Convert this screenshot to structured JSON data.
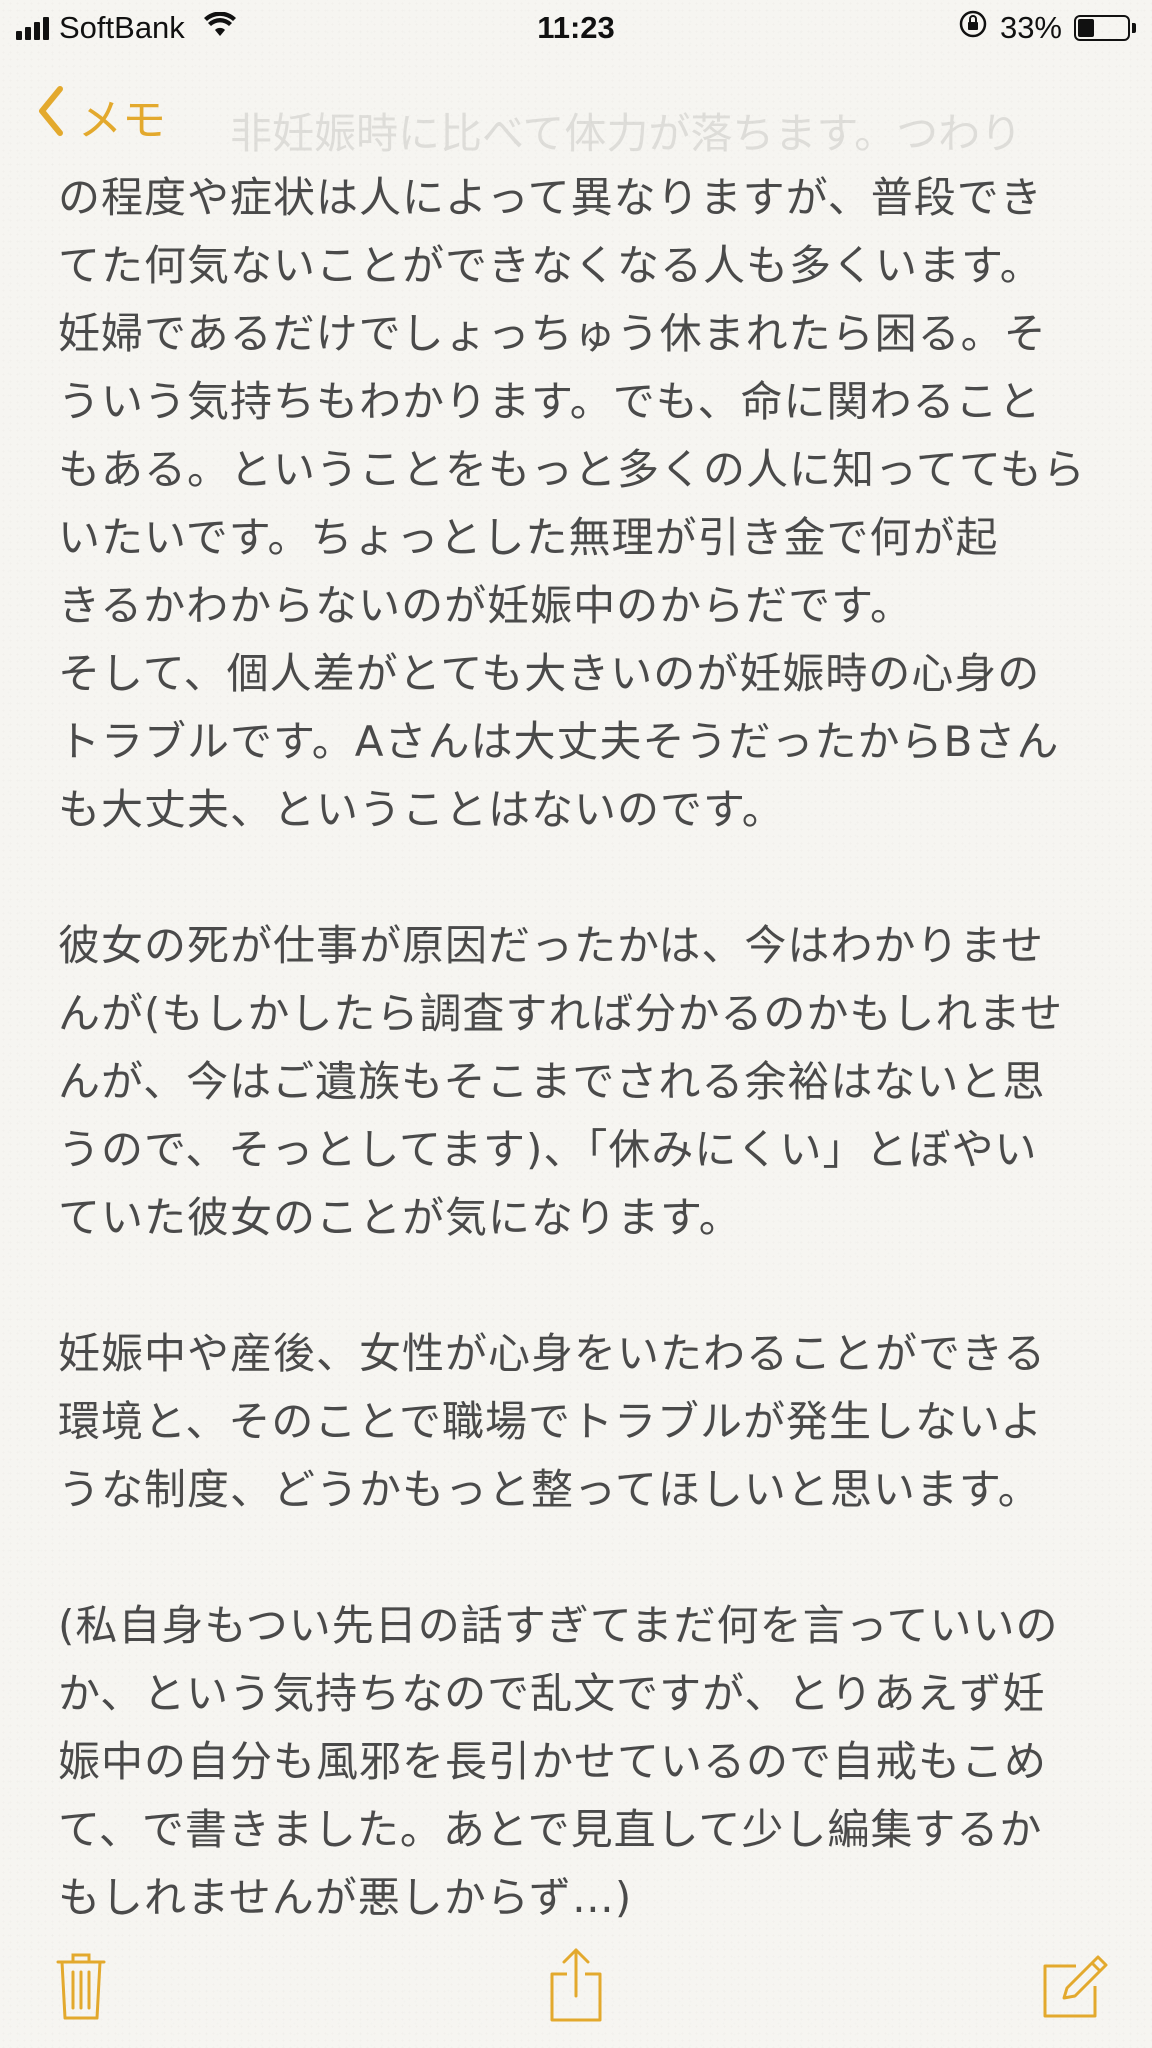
{
  "status_bar": {
    "carrier": "SoftBank",
    "time": "11:23",
    "battery_percent_label": "33%",
    "battery_level": 0.33,
    "icons": [
      "signal-icon",
      "wifi-icon",
      "orientation-lock-icon",
      "battery-icon"
    ]
  },
  "nav": {
    "back_label": "メモ",
    "faded_previous_line": "非妊娠時に比べて体力が落ちます。つわり"
  },
  "note": {
    "body": "の程度や症状は人によって異なりますが、普段でき\nてた何気ないことができなくなる人も多くいます。\n妊婦であるだけでしょっちゅう休まれたら困る。そ\nういう気持ちもわかります。でも、命に関わること\nもある。ということをもっと多くの人に知っててもら\nいたいです。ちょっとした無理が引き金で何が起\nきるかわからないのが妊娠中のからだです。\nそして、個人差がとても大きいのが妊娠時の心身の\nトラブルです。Aさんは大丈夫そうだったからBさん\nも大丈夫、ということはないのです。\n\n彼女の死が仕事が原因だったかは、今はわかりませ\nんが(もしかしたら調査すれば分かるのかもしれませ\nんが、今はご遺族もそこまでされる余裕はないと思\nうので、そっとしてます)、「休みにくい」とぼやい\nていた彼女のことが気になります。\n\n妊娠中や産後、女性が心身をいたわることができる\n環境と、そのことで職場でトラブルが発生しないよ\nうな制度、どうかもっと整ってほしいと思います。\n\n(私自身もつい先日の話すぎてまだ何を言っていいの\nか、という気持ちなので乱文ですが、とりあえず妊\n娠中の自分も風邪を長引かせているので自戒もこめ\nて、で書きました。あとで見直して少し編集するか\nもしれませんが悪しからず…)"
  },
  "toolbar": {
    "icons": [
      "trash-icon",
      "share-icon",
      "compose-icon"
    ]
  },
  "colors": {
    "accent": "#e3a92d",
    "text": "#4a4a4a",
    "background": "#f6f5f1"
  }
}
